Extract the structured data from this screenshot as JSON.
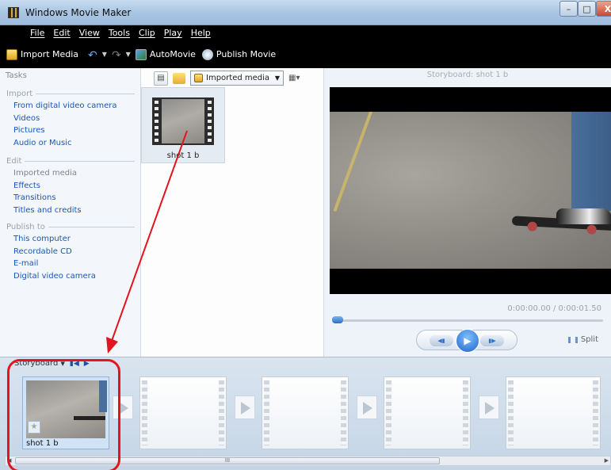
{
  "window": {
    "title": "Windows Movie Maker",
    "controls": {
      "minimize": "–",
      "maximize": "□",
      "close": "X"
    }
  },
  "menu": [
    "File",
    "Edit",
    "View",
    "Tools",
    "Clip",
    "Play",
    "Help"
  ],
  "toolbar": {
    "import_media": "Import Media",
    "automovie": "AutoMovie",
    "publish_movie": "Publish Movie"
  },
  "tasks": {
    "header": "Tasks",
    "sections": [
      {
        "title": "Import",
        "items": [
          {
            "label": "From digital video camera",
            "enabled": true
          },
          {
            "label": "Videos",
            "enabled": true
          },
          {
            "label": "Pictures",
            "enabled": true
          },
          {
            "label": "Audio or Music",
            "enabled": true
          }
        ]
      },
      {
        "title": "Edit",
        "items": [
          {
            "label": "Imported media",
            "enabled": false
          },
          {
            "label": "Effects",
            "enabled": true
          },
          {
            "label": "Transitions",
            "enabled": true
          },
          {
            "label": "Titles and credits",
            "enabled": true
          }
        ]
      },
      {
        "title": "Publish to",
        "items": [
          {
            "label": "This computer",
            "enabled": true
          },
          {
            "label": "Recordable CD",
            "enabled": true
          },
          {
            "label": "E-mail",
            "enabled": true
          },
          {
            "label": "Digital video camera",
            "enabled": true
          }
        ]
      }
    ]
  },
  "collection": {
    "selected": "Imported media",
    "items": [
      {
        "label": "shot 1 b"
      }
    ]
  },
  "preview": {
    "title": "Storyboard: shot 1 b",
    "timecode": "0:00:00.00 / 0:00:01.50",
    "progress": 0,
    "split_label": "Split"
  },
  "storyboard": {
    "label": "Storyboard",
    "clips": [
      {
        "label": "shot 1 b"
      }
    ],
    "empty_slots": 4,
    "scroll_grip": "III"
  },
  "colors": {
    "annotation": "#e3141d",
    "link": "#1a56b8",
    "toolbar_bg": "#000000"
  }
}
